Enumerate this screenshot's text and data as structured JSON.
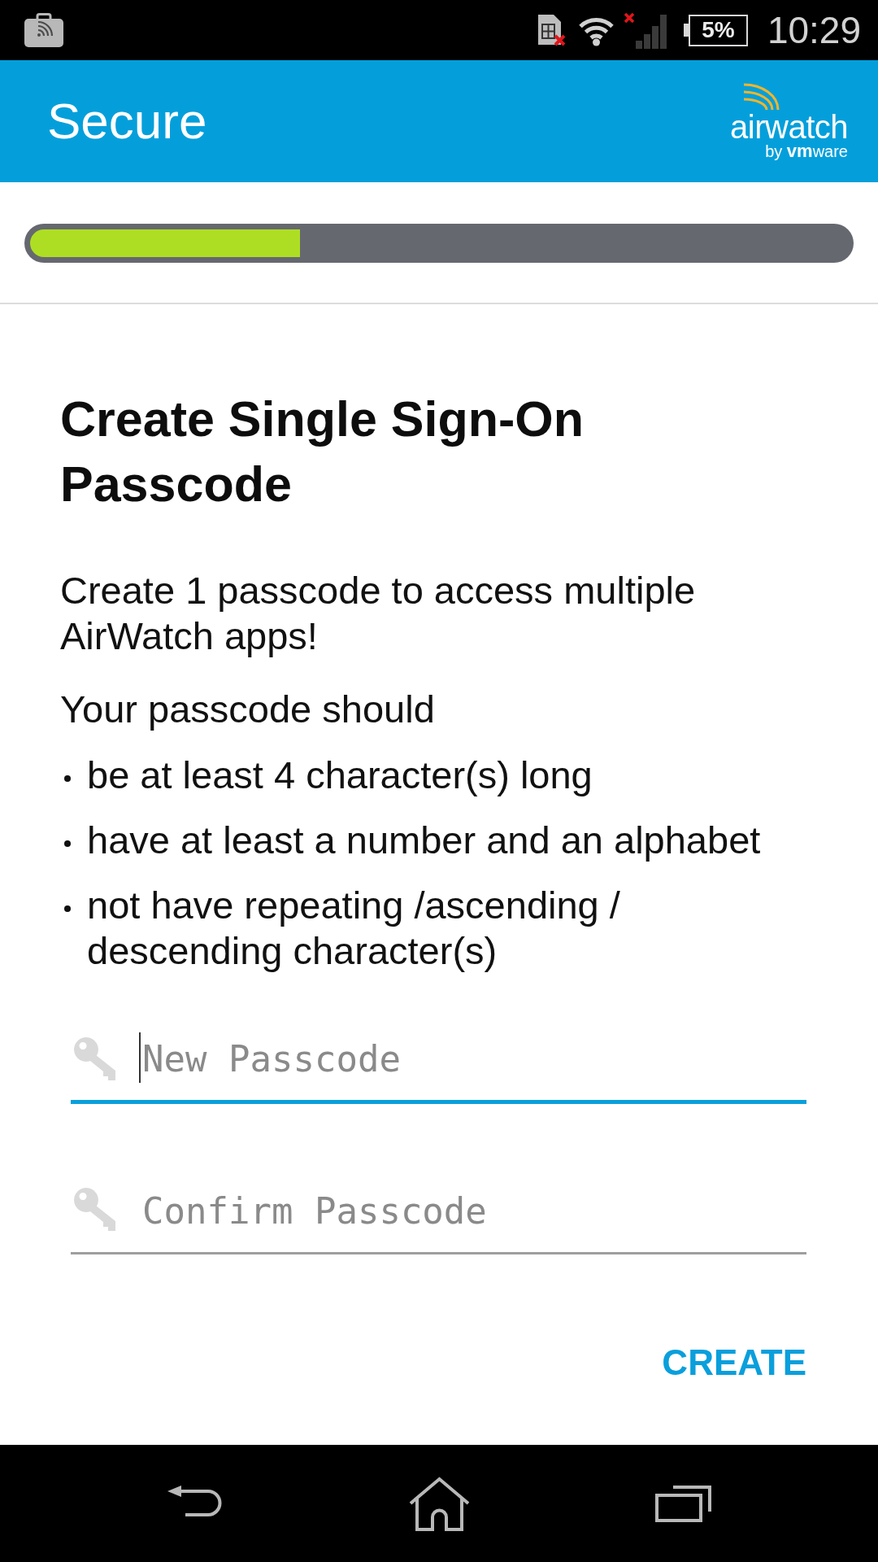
{
  "status_bar": {
    "battery": "5%",
    "time": "10:29"
  },
  "app_bar": {
    "title": "Secure",
    "logo": {
      "name": "airwatch",
      "byline": "by **vm**ware"
    }
  },
  "progress": {
    "level": 0.33
  },
  "heading": "Create Single Sign-On Passcode",
  "intro": "Create 1 passcode to access multiple AirWatch apps!",
  "rules_title": "Your passcode should",
  "rules": [
    "be at least 4 character(s) long",
    "have at least a number and an alphabet",
    "not have repeating /ascending / descending character(s)"
  ],
  "fields": [
    {
      "placeholder": "New Passcode",
      "focused": true
    },
    {
      "placeholder": "Confirm Passcode",
      "focused": false
    }
  ],
  "create_button": {
    "label": "CREATE"
  }
}
